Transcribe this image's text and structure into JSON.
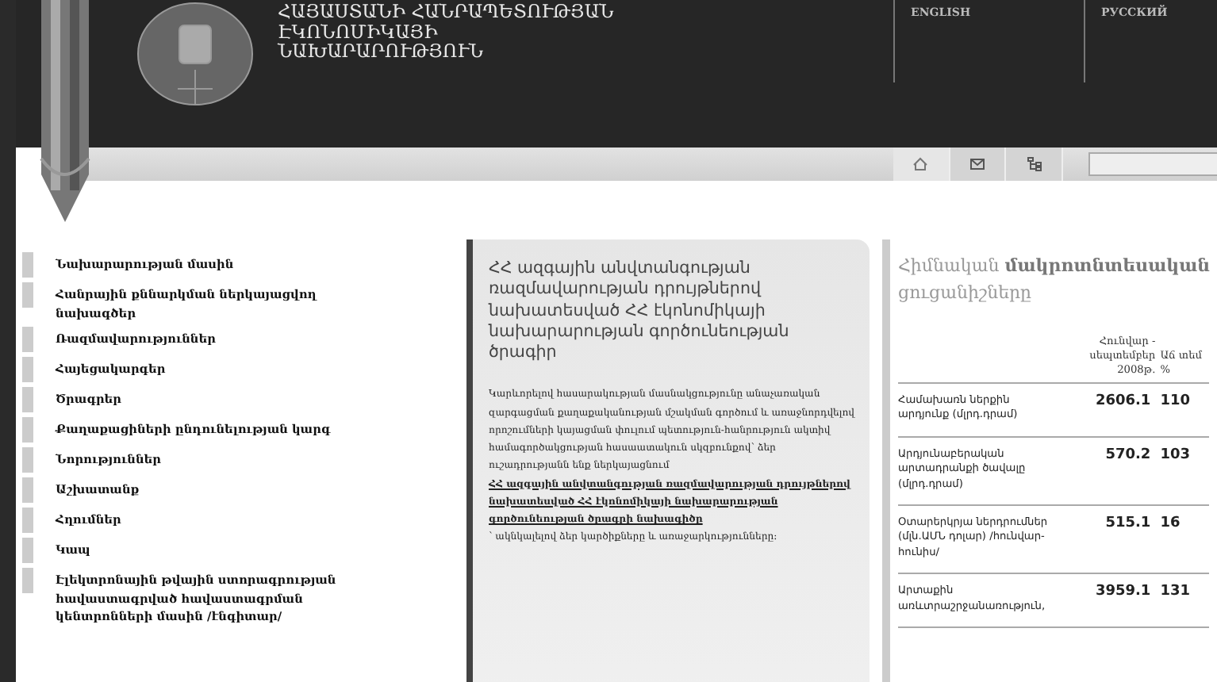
{
  "header": {
    "title_lines": [
      "ՀԱՅԱՍՏԱՆԻ ՀԱՆՐԱՊԵՏՈՒԹՅԱՆ",
      "ԷԿՈՆՈՄԻԿԱՅԻ",
      "ՆԱԽԱՐԱՐՈՒԹՅՈՒՆ"
    ],
    "languages": [
      "ENGLISH",
      "РУССКИЙ"
    ]
  },
  "menu": [
    {
      "label": "Նախարարության մասին"
    },
    {
      "label": "Հանրային քննարկման ներկայացվող նախագծեր"
    },
    {
      "label": "Ռազմավարություններ"
    },
    {
      "label": "Հայեցակարգեր"
    },
    {
      "label": "Ծրագրեր"
    },
    {
      "label": "Քաղաքացիների ընդունելության կարգ"
    },
    {
      "label": "Նորություններ"
    },
    {
      "label": "Աշխատանք"
    },
    {
      "label": "Հղումներ"
    },
    {
      "label": "Կապ"
    },
    {
      "label": "Էլեկտրոնային թվային ստորագրության հավաստագրված հավաստագրման կենտրոնների մասին /էնգիտար/"
    }
  ],
  "program": {
    "title": "ՀՀ ազգային անվտանգության ռազմավարության դրույթներով նախատեսված ՀՀ էկոնոմիկայի նախարարության գործունեության ծրագիր",
    "text_before": "Կարևորելով հասարակության մասնակցությունը անաչառական զարգացման քաղաքականության մշակման գործում և առաջնորդվելով որոշումների կայացման փուլում պետություն-հանրություն ակտիվ համագործակցության հասաատակուն սկզբունքով՝ ձեր ուշադրությանն ենք ներկայացնում",
    "link": "ՀՀ ազգային անվտանգության ռազմավարության դրույթներով նախատեսված ՀՀ էկոնոմիկայի նախարարության գործունեության ծրագրի նախագիծը",
    "text_after": "՝ ակնկալելով ձեր կարծիքները և առաջարկությունները:"
  },
  "indicators": {
    "title": "Հիմնական **մակրոտնտեսական** ցուցանիշները",
    "columns": [
      "Հունվար - սեպտեմբեր 2008թ.",
      "Աճ տեմ %"
    ],
    "rows": [
      {
        "label": "Համախառն ներքին արդյունք (մլրդ.դրամ)",
        "value": "2606.1",
        "growth": "110"
      },
      {
        "label": "Արդյունաբերական արտադրանքի ծավալը (մլրդ.դրամ)",
        "value": "570.2",
        "growth": "103"
      },
      {
        "label": "Օտարերկրյա ներդրումներ (մլն.ԱՄՆ դոլար) /հունվար-հունիս/",
        "value": "515.1",
        "growth": "16"
      },
      {
        "label": "Արտաքին առևտրաշրջանառություն,",
        "value": "3959.1",
        "growth": "131"
      }
    ]
  }
}
